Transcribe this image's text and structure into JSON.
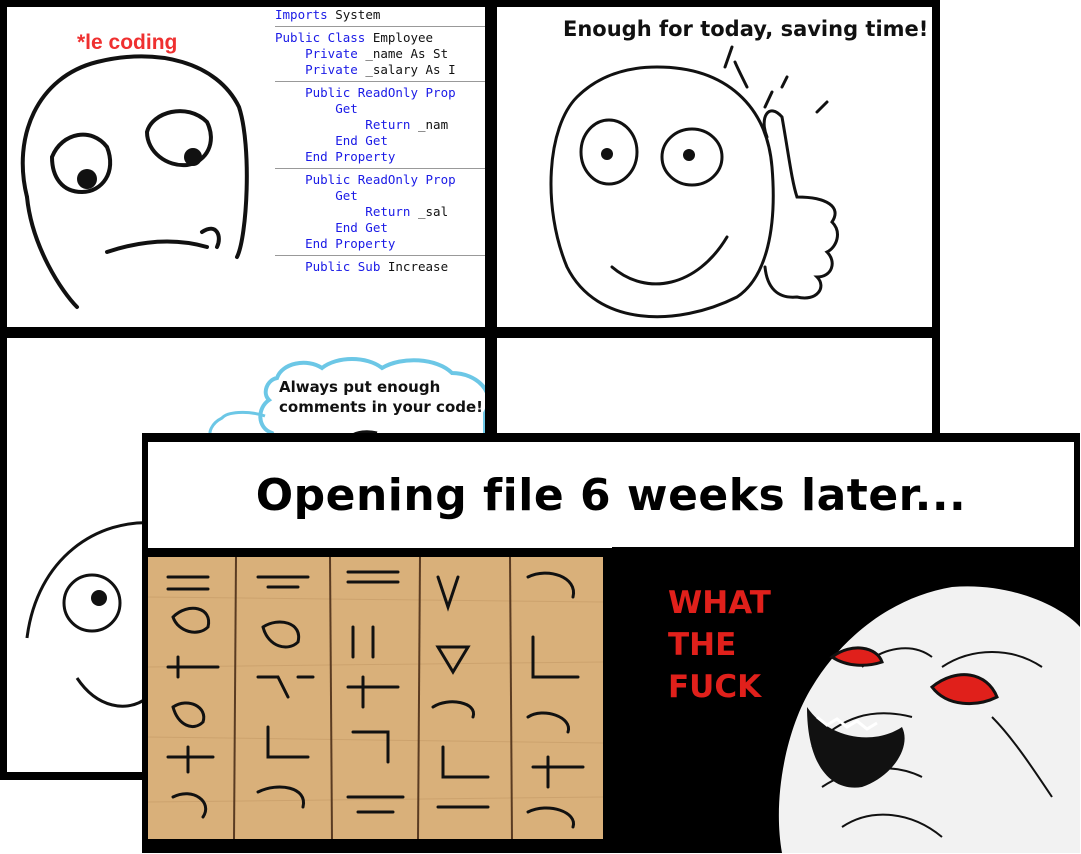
{
  "panel1": {
    "caption": "*le coding",
    "code_lines": [
      {
        "kw": "Imports",
        "rest": " System"
      },
      {
        "sep": true
      },
      {
        "kw": "Public Class",
        "rest": " Employee"
      },
      {
        "kw": "    Private",
        "rest": " _name As St"
      },
      {
        "kw": "    Private",
        "rest": " _salary As I"
      },
      {
        "sep": true
      },
      {
        "kw": "    Public ReadOnly Prop",
        "rest": ""
      },
      {
        "kw": "        Get",
        "rest": ""
      },
      {
        "kw": "            Return",
        "rest": " _nam"
      },
      {
        "kw": "        End Get",
        "rest": ""
      },
      {
        "kw": "    End Property",
        "rest": ""
      },
      {
        "sep": true
      },
      {
        "kw": "    Public ReadOnly Prop",
        "rest": ""
      },
      {
        "kw": "        Get",
        "rest": ""
      },
      {
        "kw": "            Return",
        "rest": " _sal"
      },
      {
        "kw": "        End Get",
        "rest": ""
      },
      {
        "kw": "    End Property",
        "rest": ""
      },
      {
        "sep": true
      },
      {
        "kw": "    Public Sub",
        "rest": " Increase"
      }
    ]
  },
  "panel2": {
    "caption": "Enough for today, saving time!"
  },
  "panel3": {
    "cloud_text": "Always put enough comments in your code!"
  },
  "front": {
    "title": "Opening file 6 weeks later...",
    "exclaim": [
      "WHAT",
      "THE",
      "FUCK"
    ]
  },
  "colors": {
    "red": "#e0201b",
    "code_blue": "#1a1ae6",
    "cloud_blue": "#6cc7e6",
    "papyrus": "#d9b07a"
  }
}
